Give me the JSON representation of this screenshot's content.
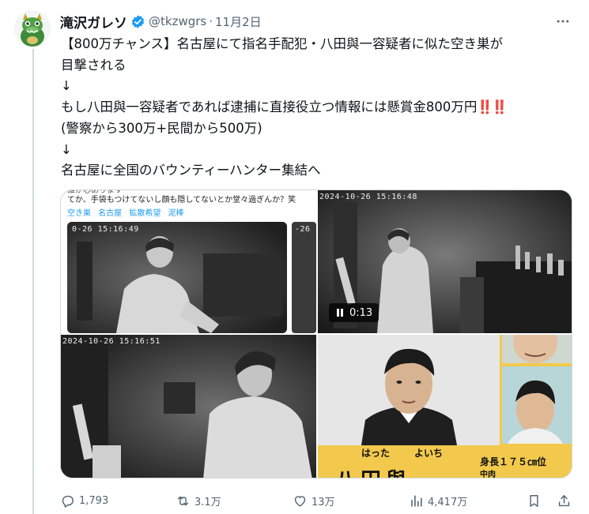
{
  "author": {
    "name": "滝沢ガレソ",
    "handle": "@tkzwgrs",
    "date": "11月2日"
  },
  "tweet": {
    "lines": [
      "【800万チャンス】名古屋にて指名手配犯・八田與一容疑者に似た空き巣が",
      "目撃される",
      "↓",
      "もし八田與一容疑者であれば逮捕に直接役立つ情報には懸賞金800万円",
      "(警察から300万+民間から500万)",
      "↓",
      "名古屋に全国のバウンティーハンター集結へ"
    ],
    "emphasis": "‼️‼️"
  },
  "media": {
    "image1": {
      "caption_top": "誰か心あります",
      "caption": "てか、手袋もつけてないし顔も隠してないとか堂々過ぎんか？笑",
      "tags": "空き巣 名古屋 拡散希望 泥棒",
      "timestamp": "0-26 15:16:49",
      "timestamp2": "-26"
    },
    "image2": {
      "timestamp": "2024-10-26 15:16:48",
      "video_duration": "0:13"
    },
    "image3": {
      "timestamp": "2024-10-26 15:16:51"
    },
    "image4": {
      "name_kana_given": "はった",
      "name_kana_family": "よいち",
      "height": "身長１７５㎝位",
      "build": "中肉",
      "name_kanji": "八田與一"
    }
  },
  "actions": {
    "replies": "1,793",
    "reposts": "3.1万",
    "likes": "13万",
    "views": "4,417万"
  },
  "colors": {
    "text": "#0f1419",
    "secondary": "#536471",
    "verified": "#1d9bf0",
    "emphasis": "#e0245e",
    "poster_bg": "#f2c94c"
  }
}
